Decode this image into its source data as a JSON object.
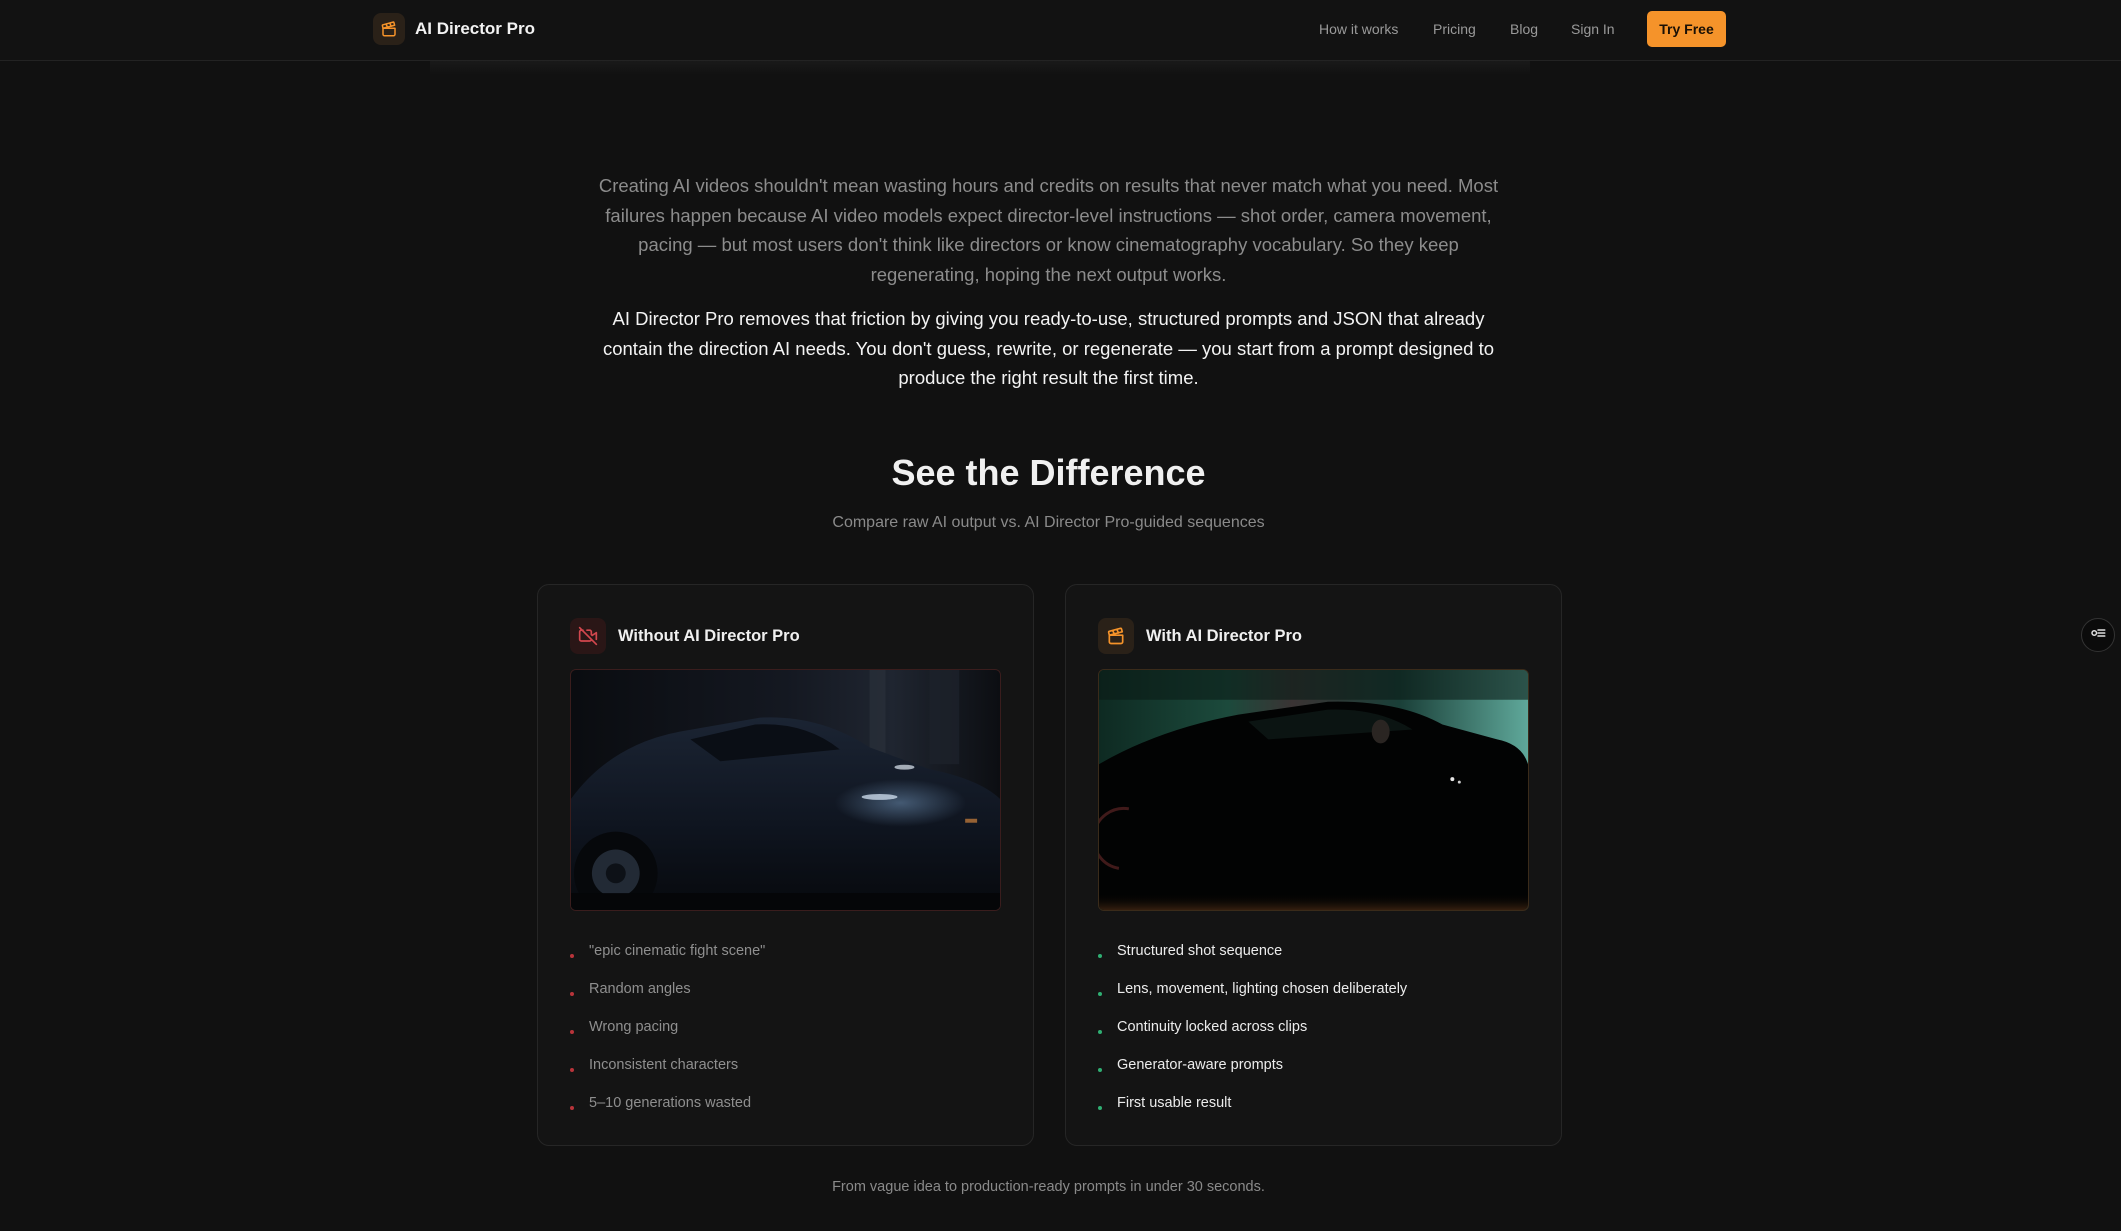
{
  "header": {
    "brand": "AI Director Pro",
    "nav": [
      {
        "label": "How it works"
      },
      {
        "label": "Pricing"
      },
      {
        "label": "Blog"
      },
      {
        "label": "Sign In"
      }
    ],
    "cta": "Try Free"
  },
  "intro": {
    "paragraph": "Creating AI videos shouldn't mean wasting hours and credits on results that never match what you need. Most failures happen because AI video models expect director-level instructions — shot order, camera movement, pacing — but most users don't think like directors or know cinematography vocabulary. So they keep regenerating, hoping the next output works.",
    "highlight": "AI Director Pro removes that friction by giving you ready-to-use, structured prompts and JSON that already contain the direction AI needs. You don't guess, rewrite, or regenerate — you start from a prompt designed to produce the right result the first time."
  },
  "comparison": {
    "title": "See the Difference",
    "subtitle": "Compare raw AI output vs. AI Director Pro-guided sequences",
    "without": {
      "title": "Without AI Director Pro",
      "icon": "video-off-icon",
      "items": [
        "\"epic cinematic fight scene\"",
        "Random angles",
        "Wrong pacing",
        "Inconsistent characters",
        "5–10 generations wasted"
      ]
    },
    "with": {
      "title": "With AI Director Pro",
      "icon": "clapperboard-icon",
      "items": [
        "Structured shot sequence",
        "Lens, movement, lighting chosen deliberately",
        "Continuity locked across clips",
        "Generator-aware prompts",
        "First usable result"
      ]
    }
  },
  "footnote": "From vague idea to production-ready prompts in under 30 seconds.",
  "colors": {
    "accent": "#f5932a",
    "negative": "#b8343a",
    "positive": "#2fae72",
    "background": "#111111"
  }
}
